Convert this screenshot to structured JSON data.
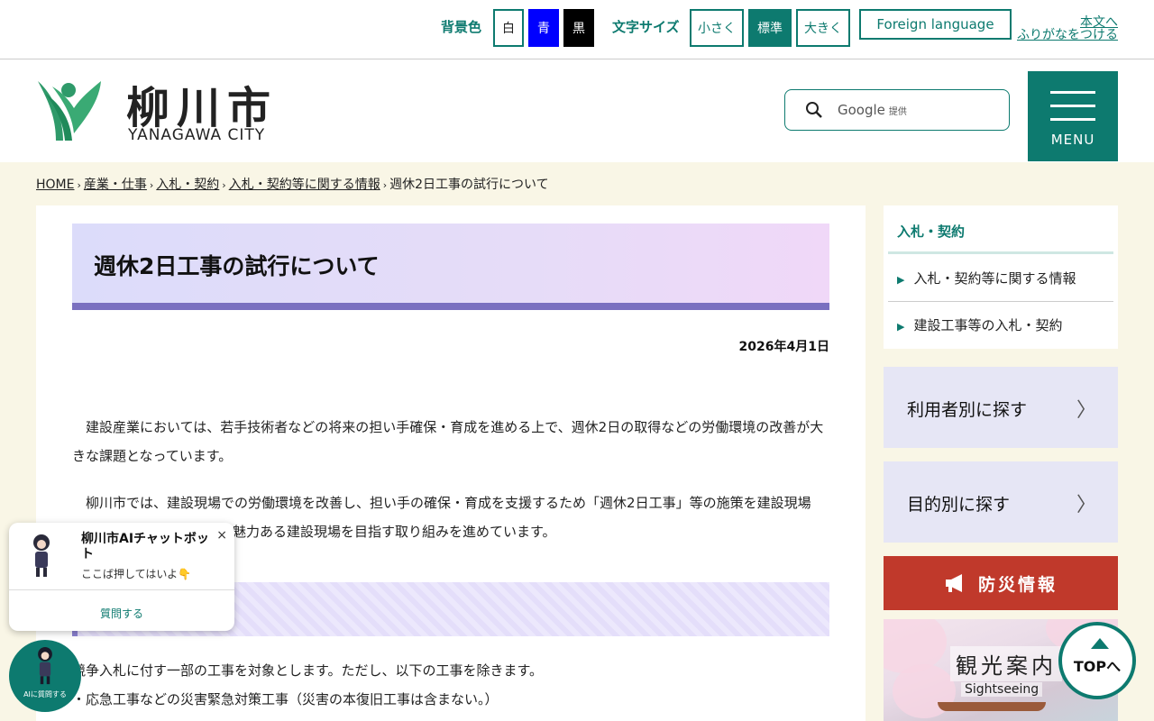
{
  "topbar": {
    "bg_label": "背景色",
    "bg_white": "白",
    "bg_blue": "青",
    "bg_black": "黒",
    "fs_label": "文字サイズ",
    "fs_small": "小さく",
    "fs_standard": "標準",
    "fs_large": "大きく",
    "foreign": "Foreign language",
    "skip_link": "本文へ",
    "furigana_link": "ふりがなをつける"
  },
  "header": {
    "logo_jp": "柳川市",
    "logo_en": "YANAGAWA CITY",
    "search_placeholder": "Google",
    "search_provider": "提供",
    "menu_label": "MENU"
  },
  "breadcrumb": {
    "items": [
      "HOME",
      "産業・仕事",
      "入札・契約",
      "入札・契約等に関する情報"
    ],
    "current": "週休2日工事の試行について",
    "sep": "›"
  },
  "article": {
    "title": "週休2日工事の試行について",
    "date": "2026年4月1日",
    "p1": "建設産業においては、若手技術者などの将来の担い手確保・育成を進める上で、週休2日の取得などの労働環境の改善が大きな課題となっています。",
    "p2_line1": "柳川市では、建設現場での労働環境を改善し、担い手の確保・育成を支援するため「週休2日工事」等の施策を建設現場",
    "p2_line2": "魅力ある建設現場を目指す取り組みを進めています。",
    "list1": "競争入札に付す一部の工事を対象とします。ただし、以下の工事を除きます。",
    "list2": "・応急工事などの災害緊急対策工事（災害の本復旧工事は含まない。）"
  },
  "sidebar": {
    "nav_title": "入札・契約",
    "nav_items": [
      "入札・契約等に関する情報",
      "建設工事等の入札・契約"
    ],
    "box_user": "利用者別に探す",
    "box_purpose": "目的別に探す",
    "chev": "〉",
    "bousai": "防災情報",
    "kanko_jp": "観光案内",
    "kanko_en": "Sightseeing"
  },
  "top_button": "TOPへ",
  "chatbot": {
    "title": "柳川市AIチャットボット",
    "subtitle": "ここば押してはいよ👇",
    "close": "×",
    "ask": "質問する",
    "circle_label": "AIに質問する"
  },
  "colors": {
    "brand": "#0d7a6f",
    "title_band": "#7a70c0",
    "bousai": "#c0392b",
    "main_bg": "#f9f6e6"
  }
}
